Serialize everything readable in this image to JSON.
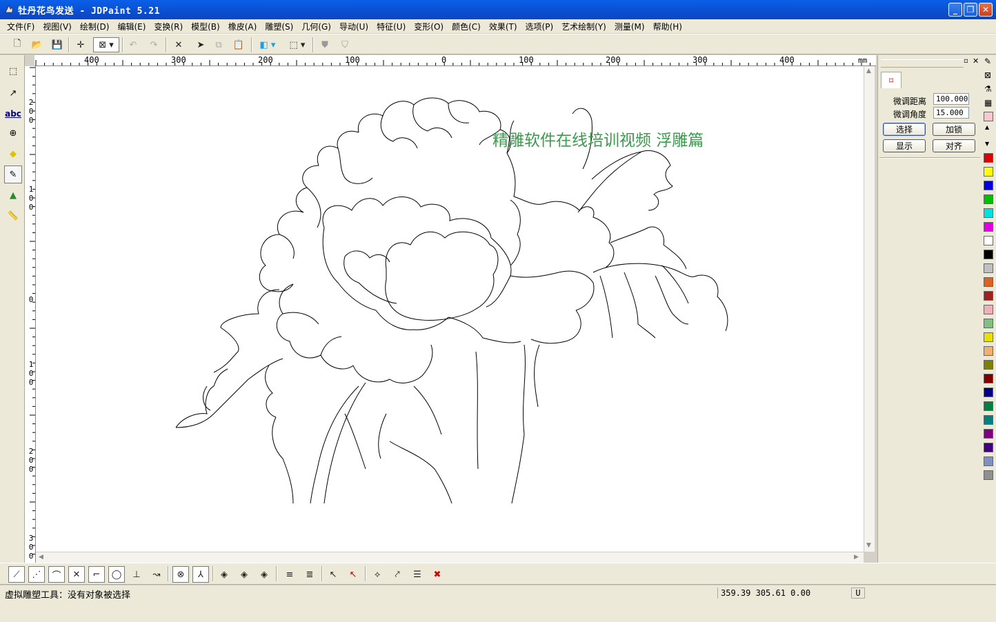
{
  "window": {
    "title": "牡丹花鸟发送 - JDPaint 5.21",
    "controls": [
      "minimize",
      "restore",
      "close"
    ]
  },
  "menu": [
    "文件(F)",
    "视图(V)",
    "绘制(D)",
    "编辑(E)",
    "变换(R)",
    "模型(B)",
    "橡皮(A)",
    "雕塑(S)",
    "几何(G)",
    "导动(U)",
    "特征(U)",
    "变形(O)",
    "颜色(C)",
    "效果(T)",
    "选项(P)",
    "艺术绘制(Y)",
    "测量(M)",
    "帮助(H)"
  ],
  "ruler": {
    "unit": "mm",
    "h_ticks": [
      "400",
      "300",
      "200",
      "100",
      "0",
      "100",
      "200",
      "300",
      "400"
    ],
    "v_ticks": [
      "200",
      "100",
      "0",
      "100",
      "200",
      "300"
    ]
  },
  "canvas": {
    "watermark": "精雕软件在线培训视频  浮雕篇"
  },
  "panel": {
    "fine_distance_label": "微调距离",
    "fine_distance_value": "100.000",
    "fine_angle_label": "微调角度",
    "fine_angle_value": "15.000",
    "buttons": {
      "select": "选择",
      "lock": "加锁",
      "show": "显示",
      "align": "对齐"
    }
  },
  "palette": [
    "#e00000",
    "#ffff00",
    "#0000e0",
    "#00c000",
    "#00e0e0",
    "#e000e0",
    "#ffffff",
    "#000000",
    "#c0c0c0",
    "#e06020",
    "#a02020",
    "#f0b0b8",
    "#80c080",
    "#e8e000",
    "#f0b070",
    "#808000",
    "#800000",
    "#000080",
    "#008040",
    "#008080",
    "#800080",
    "#400080",
    "#8090c0",
    "#909090"
  ],
  "status": {
    "message": "虚拟雕塑工具：没有对象被选择",
    "coords": "359.39 305.61 0.00",
    "unit": "U"
  }
}
